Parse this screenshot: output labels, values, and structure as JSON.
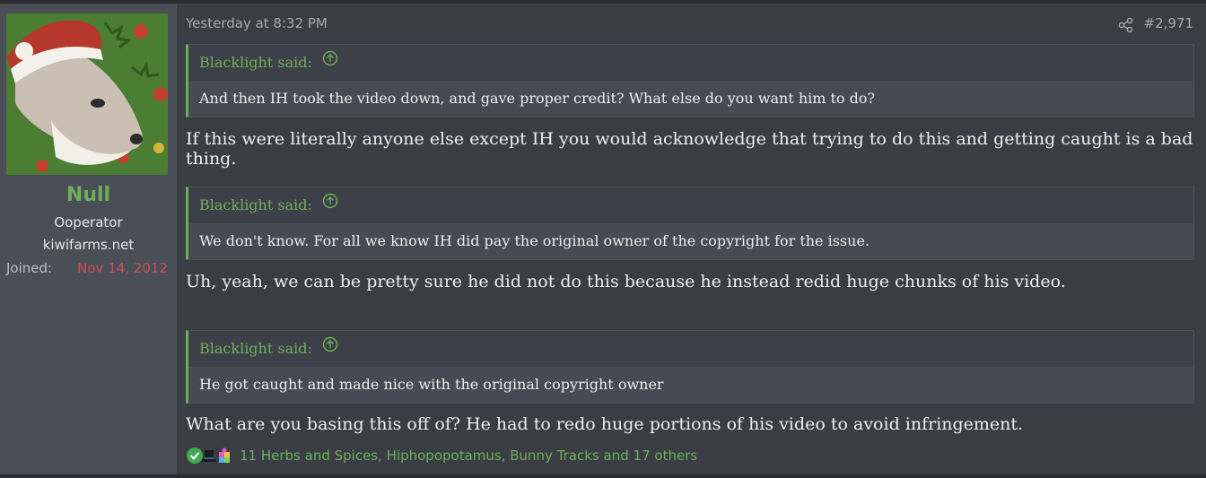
{
  "post": {
    "timestamp": "Yesterday at 8:32 PM",
    "post_number": "#2,971",
    "colors": {
      "accent": "#6fae59",
      "joined_date": "#c9504f"
    }
  },
  "user": {
    "name": "Null",
    "title": "Ooperator",
    "banner": "kiwifarms.net",
    "joined_label": "Joined:",
    "joined_value": "Nov 14, 2012"
  },
  "quotes": [
    {
      "author": "Blacklight said:",
      "text": "And then IH took the video down, and gave proper credit? What else do you want him to do?"
    },
    {
      "author": "Blacklight said:",
      "text": "We don't know. For all we know IH did pay the original owner of the copyright for the issue."
    },
    {
      "author": "Blacklight said:",
      "text": "He got caught and made nice with the original copyright owner"
    }
  ],
  "replies": [
    "If this were literally anyone else except IH you would acknowledge that trying to do this and getting caught is a bad thing.",
    "Uh, yeah, we can be pretty sure he did not do this because he instead redid huge chunks of his video.",
    "What are you basing this off of? He had to redo huge portions of his video to avoid infringement."
  ],
  "reactions": {
    "icons": [
      "check-icon",
      "top-hat-icon",
      "puzzle-icon"
    ],
    "text": "11 Herbs and Spices, Hiphopopotamus, Bunny Tracks and 17 others"
  }
}
